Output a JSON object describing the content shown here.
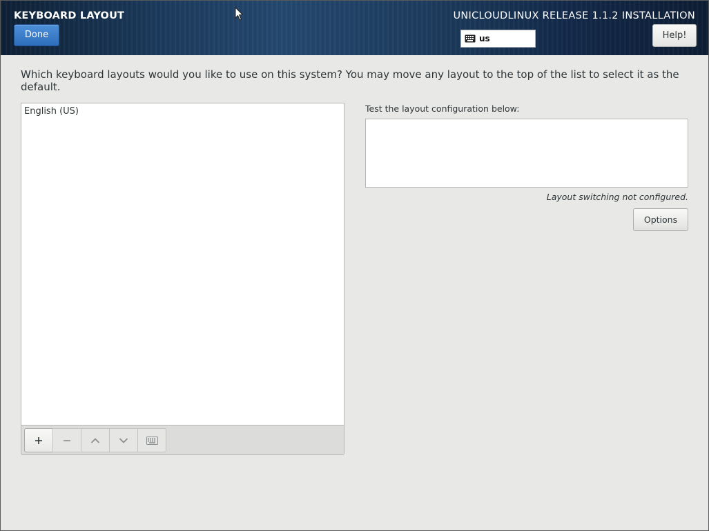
{
  "header": {
    "page_title": "KEYBOARD LAYOUT",
    "done_label": "Done",
    "product_title": "UNICLOUDLINUX RELEASE 1.1.2 INSTALLATION",
    "keyboard_indicator": {
      "icon": "keyboard-icon",
      "value": "us"
    },
    "help_label": "Help!"
  },
  "main": {
    "question": "Which keyboard layouts would you like to use on this system?  You may move any layout to the top of the list to select it as the default.",
    "layouts": [
      "English (US)"
    ],
    "toolbar": {
      "buttons": [
        {
          "name": "add",
          "glyph": "+",
          "active": true
        },
        {
          "name": "remove",
          "glyph": "−",
          "active": false
        },
        {
          "name": "move-up",
          "glyph": "chevron-up-icon",
          "active": false
        },
        {
          "name": "move-down",
          "glyph": "chevron-down-icon",
          "active": false
        },
        {
          "name": "preview",
          "glyph": "keyboard-icon",
          "active": false
        }
      ]
    },
    "test_label": "Test the layout configuration below:",
    "test_value": "",
    "switching_note": "Layout switching not configured.",
    "options_label": "Options"
  },
  "colors": {
    "primary_button": "#3b7dcc",
    "background": "#e8e8e7"
  }
}
